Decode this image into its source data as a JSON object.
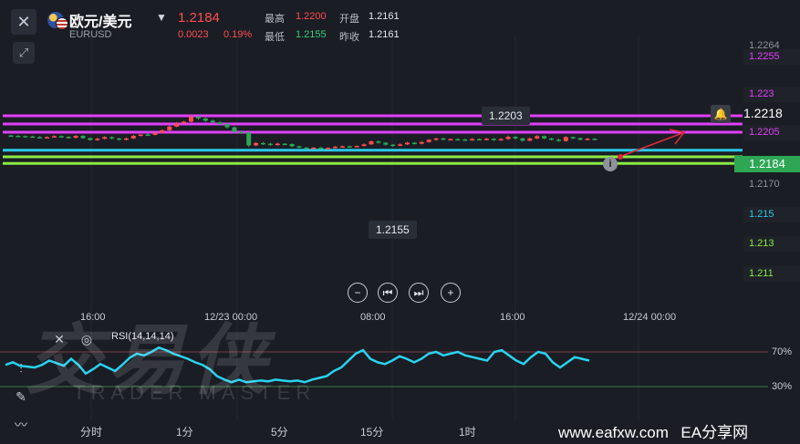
{
  "header": {
    "pair_name": "欧元/美元",
    "pair_code": "EURUSD",
    "price": "1.2184",
    "change": "0.0023",
    "change_pct": "0.19%",
    "stats": {
      "high_label": "最高",
      "high": "1.2200",
      "open_label": "开盘",
      "open": "1.2161",
      "low_label": "最低",
      "low": "1.2155",
      "prev_label": "昨收",
      "prev": "1.2161"
    }
  },
  "price_axis": {
    "top": "1.2264",
    "lines": [
      {
        "label": "1.2255",
        "color": "#e040fb",
        "price": 1.2255
      },
      {
        "label": "1.223",
        "color": "#e040fb",
        "price": 1.223
      },
      {
        "label": "1.2205",
        "color": "#e040fb",
        "price": 1.2205
      },
      {
        "label": "1.215",
        "color": "#29c8e8",
        "price": 1.215
      },
      {
        "label": "1.213",
        "color": "#8bea44",
        "price": 1.213
      },
      {
        "label": "1.211",
        "color": "#8bea44",
        "price": 1.211
      }
    ],
    "current": "1.2184",
    "mid": "1.2170",
    "alert_price": "1.2218"
  },
  "callouts": {
    "high": "1.2203",
    "low": "1.2155"
  },
  "time_axis": [
    "16:00",
    "12/23 00:00",
    "08:00",
    "16:00",
    "12/24 00:00"
  ],
  "rsi": {
    "title": "RSI(14,14,14)",
    "upper": "70%",
    "lower": "30%"
  },
  "timeframes": [
    "分时",
    "1分",
    "5分",
    "15分",
    "1时"
  ],
  "watermark": {
    "big": "交易侠",
    "small": "TRADER MASTER"
  },
  "footer": {
    "site": "www.eafxw.com",
    "brand": "EA分享网"
  },
  "icons": [
    "close-icon",
    "expand-icon",
    "bell-icon",
    "zoom-out-icon",
    "prev-icon",
    "next-icon",
    "zoom-in-icon",
    "crosshair-icon",
    "eye-icon",
    "candle-tool-icon",
    "pencil-icon",
    "wave-icon",
    "info-icon"
  ],
  "colors": {
    "up": "#ff4d4f",
    "down": "#2ea654",
    "rsi": "#29d3f0"
  }
}
